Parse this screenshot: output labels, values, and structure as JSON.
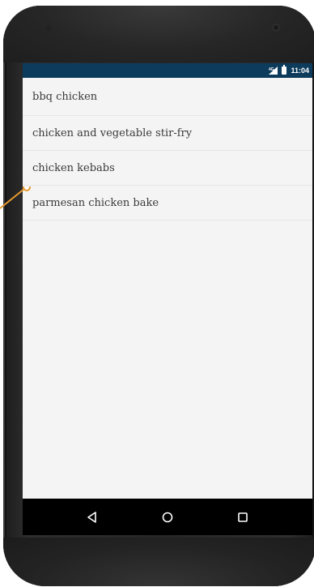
{
  "statusbar": {
    "time": "11:04",
    "signal_icon": "signal-icon",
    "battery_icon": "battery-icon",
    "bg_color": "#0d3b5c"
  },
  "recipes": {
    "items": [
      {
        "label": "bbq chicken"
      },
      {
        "label": "chicken and vegetable stir-fry"
      },
      {
        "label": "chicken kebabs"
      },
      {
        "label": "parmesan chicken bake"
      }
    ]
  },
  "navbar": {
    "back_icon": "back-icon",
    "home_icon": "home-icon",
    "recents_icon": "recents-icon"
  },
  "annotation": {
    "color": "#e69a2e"
  }
}
